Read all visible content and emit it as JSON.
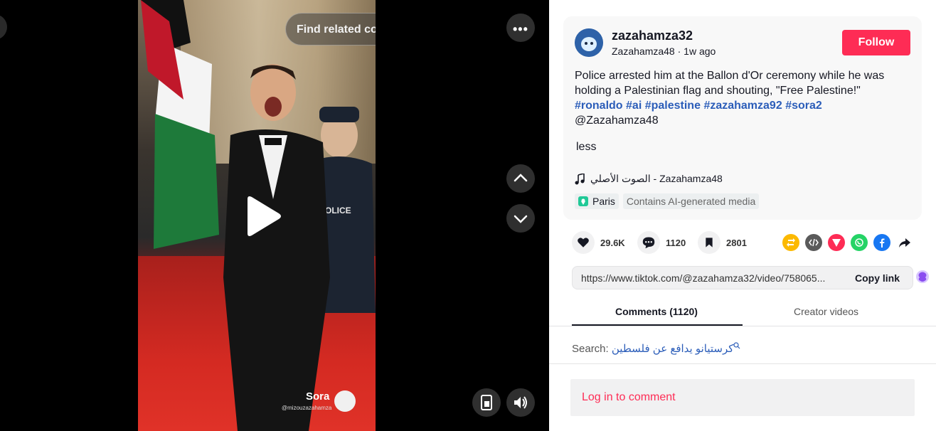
{
  "video": {
    "search_placeholder": "Find related content",
    "more_icon": "more-dots-icon",
    "watermark_brand": "Sora",
    "watermark_handle": "@mizouzazahamza"
  },
  "post": {
    "username": "zazahamza32",
    "display_name": "Zazahamza48",
    "time": "1w ago",
    "follow_label": "Follow",
    "description": "Police arrested him at the Ballon d'Or ceremony while he was holding a Palestinian flag and shouting, \"Free Palestine!\"",
    "hashtags": [
      "#ronaldo",
      "#ai",
      "#palestine",
      "#zazahamza92",
      "#sora2"
    ],
    "mention": "@Zazahamza48",
    "less_label": "less",
    "music": "الصوت الأصلي - Zazahamza48",
    "location": "Paris",
    "ai_label": "Contains AI-generated media"
  },
  "actions": {
    "likes": "29.6K",
    "comments": "1120",
    "saves": "2801"
  },
  "link": {
    "url": "https://www.tiktok.com/@zazahamza32/video/758065...",
    "copy_label": "Copy link"
  },
  "tabs": {
    "comments": "Comments (1120)",
    "creator": "Creator videos"
  },
  "comments_search": {
    "label": "Search:",
    "query": "كرستيانو يدافع عن فلسطين"
  },
  "login_label": "Log in to comment",
  "colors": {
    "accent": "#fe2c55",
    "hashtag": "#2b5db9"
  }
}
